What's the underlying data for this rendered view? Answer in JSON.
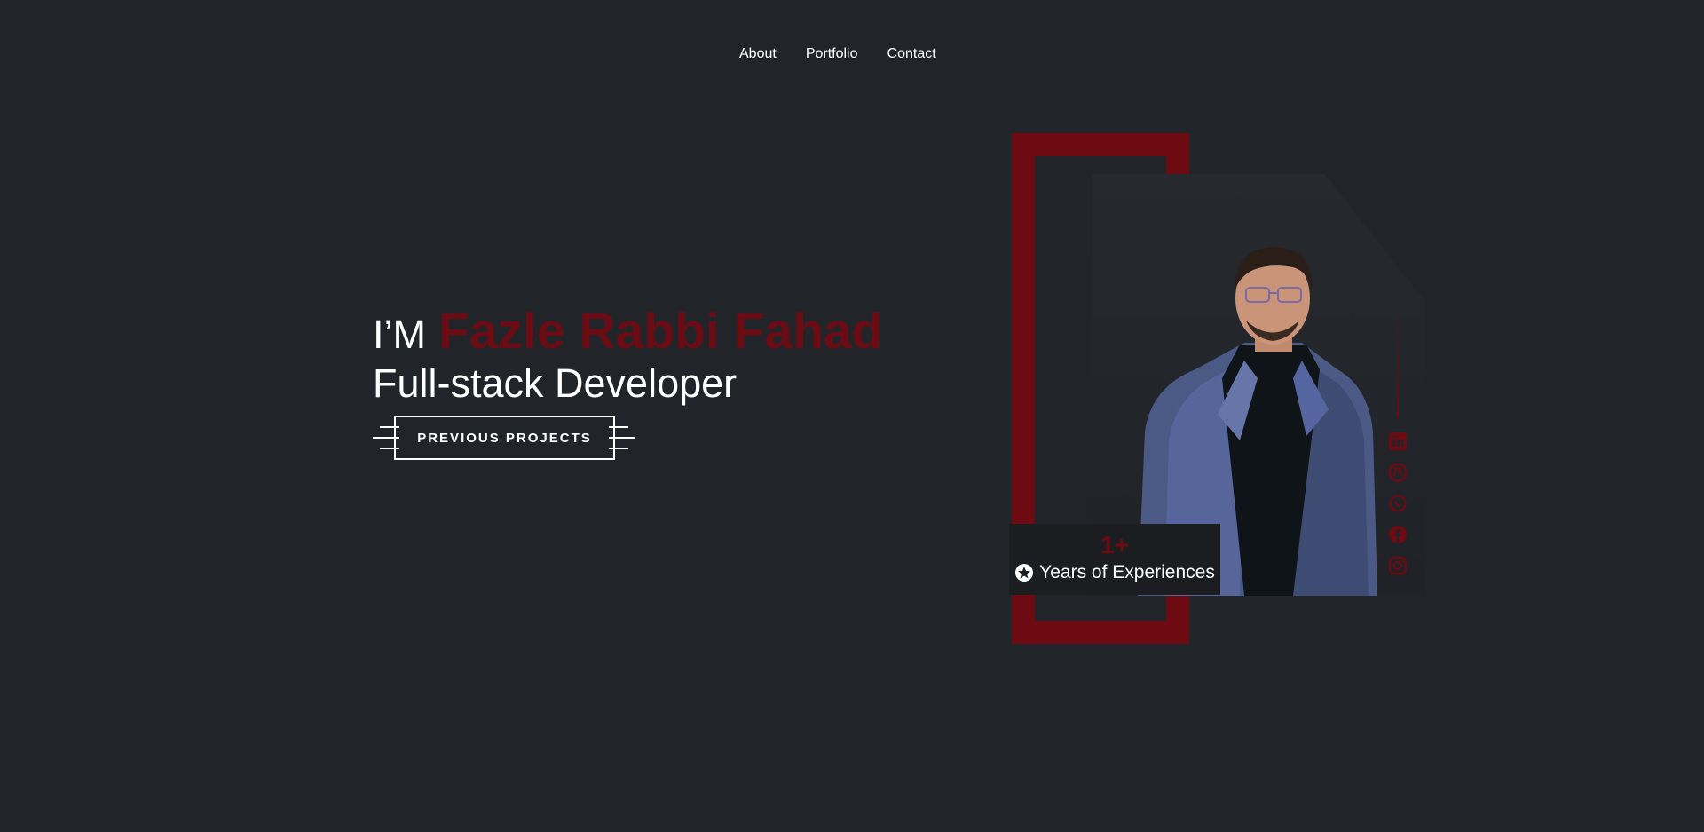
{
  "nav": {
    "items": [
      {
        "label": "About"
      },
      {
        "label": "Portfolio"
      },
      {
        "label": "Contact"
      }
    ]
  },
  "hero": {
    "prefix": "I’M",
    "name": "Fazle Rabbi Fahad",
    "role": "Full-stack Developer",
    "button_label": "PREVIOUS PROJECTS"
  },
  "experience": {
    "count": "1+",
    "label": "Years of Experiences"
  },
  "social": [
    {
      "icon": "linkedin-icon"
    },
    {
      "icon": "github-icon"
    },
    {
      "icon": "whatsapp-icon"
    },
    {
      "icon": "facebook-icon"
    },
    {
      "icon": "instagram-icon"
    }
  ],
  "colors": {
    "background": "#212428",
    "accent": "#6e0a12",
    "text": "#ffffff"
  }
}
